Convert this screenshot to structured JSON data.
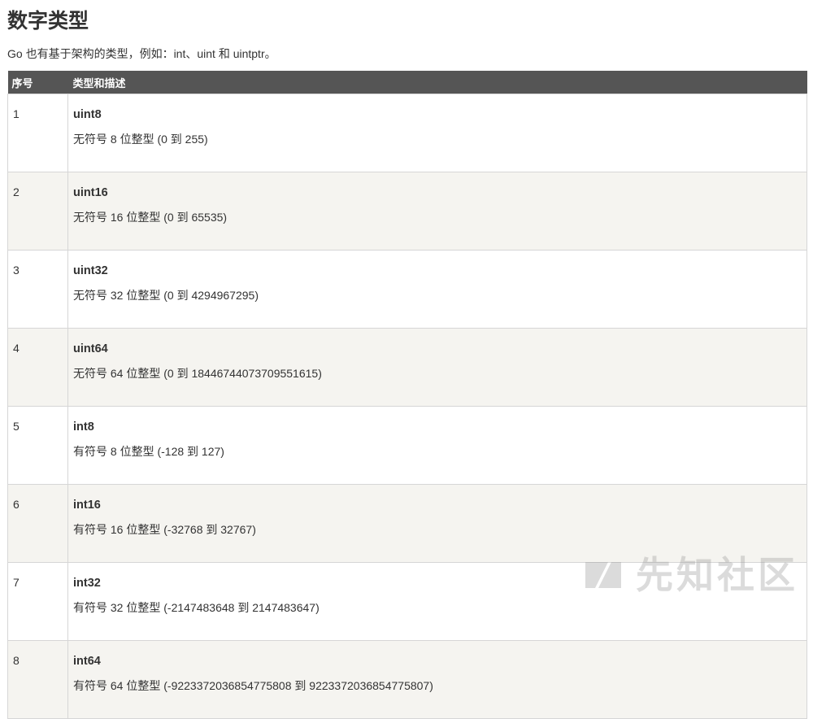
{
  "page": {
    "title": "数字类型",
    "intro": "Go 也有基于架构的类型，例如：int、uint 和 uintptr。"
  },
  "table": {
    "headers": {
      "number": "序号",
      "description": "类型和描述"
    },
    "rows": [
      {
        "number": "1",
        "type": "uint8",
        "description": "无符号 8 位整型 (0 到 255)"
      },
      {
        "number": "2",
        "type": "uint16",
        "description": "无符号 16 位整型 (0 到 65535)"
      },
      {
        "number": "3",
        "type": "uint32",
        "description": "无符号 32 位整型 (0 到 4294967295)"
      },
      {
        "number": "4",
        "type": "uint64",
        "description": "无符号 64 位整型 (0 到 18446744073709551615)"
      },
      {
        "number": "5",
        "type": "int8",
        "description": "有符号 8 位整型 (-128 到 127)"
      },
      {
        "number": "6",
        "type": "int16",
        "description": "有符号 16 位整型 (-32768 到 32767)"
      },
      {
        "number": "7",
        "type": "int32",
        "description": "有符号 32 位整型 (-2147483648 到 2147483647)"
      },
      {
        "number": "8",
        "type": "int64",
        "description": "有符号 64 位整型 (-9223372036854775808 到 9223372036854775807)"
      }
    ]
  },
  "watermark": {
    "text": "先知社区",
    "color": "#9a9a9a"
  },
  "colors": {
    "header_bg": "#555555",
    "row_alt_bg": "#f5f4f0",
    "border": "#d6d6d6",
    "text": "#333333"
  }
}
